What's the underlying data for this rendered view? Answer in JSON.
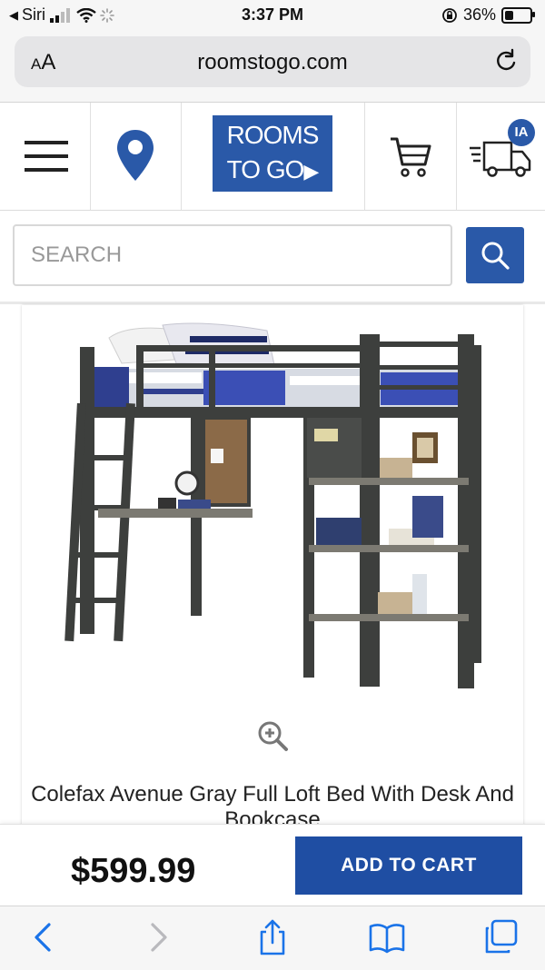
{
  "status_bar": {
    "back_label": "Siri",
    "time": "3:37 PM",
    "battery_percent": "36%",
    "battery_level": 0.36
  },
  "browser": {
    "text_size_label": "AA",
    "url": "roomstogo.com"
  },
  "header": {
    "logo_line1": "ROOMS",
    "logo_line2": "TO GO",
    "account_initials": "IA"
  },
  "search": {
    "placeholder": "SEARCH"
  },
  "product": {
    "title": "Colefax Avenue Gray Full Loft Bed With Desk And Bookcase",
    "price": "$599.99",
    "add_to_cart_label": "ADD TO CART"
  },
  "colors": {
    "brand_blue": "#2a59a8",
    "button_blue": "#1f4ea3",
    "ios_blue": "#1a73e8"
  },
  "icons": {
    "menu": "hamburger-menu-icon",
    "location": "map-pin-icon",
    "cart": "shopping-cart-icon",
    "delivery": "delivery-truck-icon",
    "search": "search-icon",
    "zoom": "zoom-in-icon",
    "back": "chevron-left-icon",
    "forward": "chevron-right-icon",
    "share": "share-icon",
    "bookmarks": "book-icon",
    "tabs": "tabs-icon"
  }
}
